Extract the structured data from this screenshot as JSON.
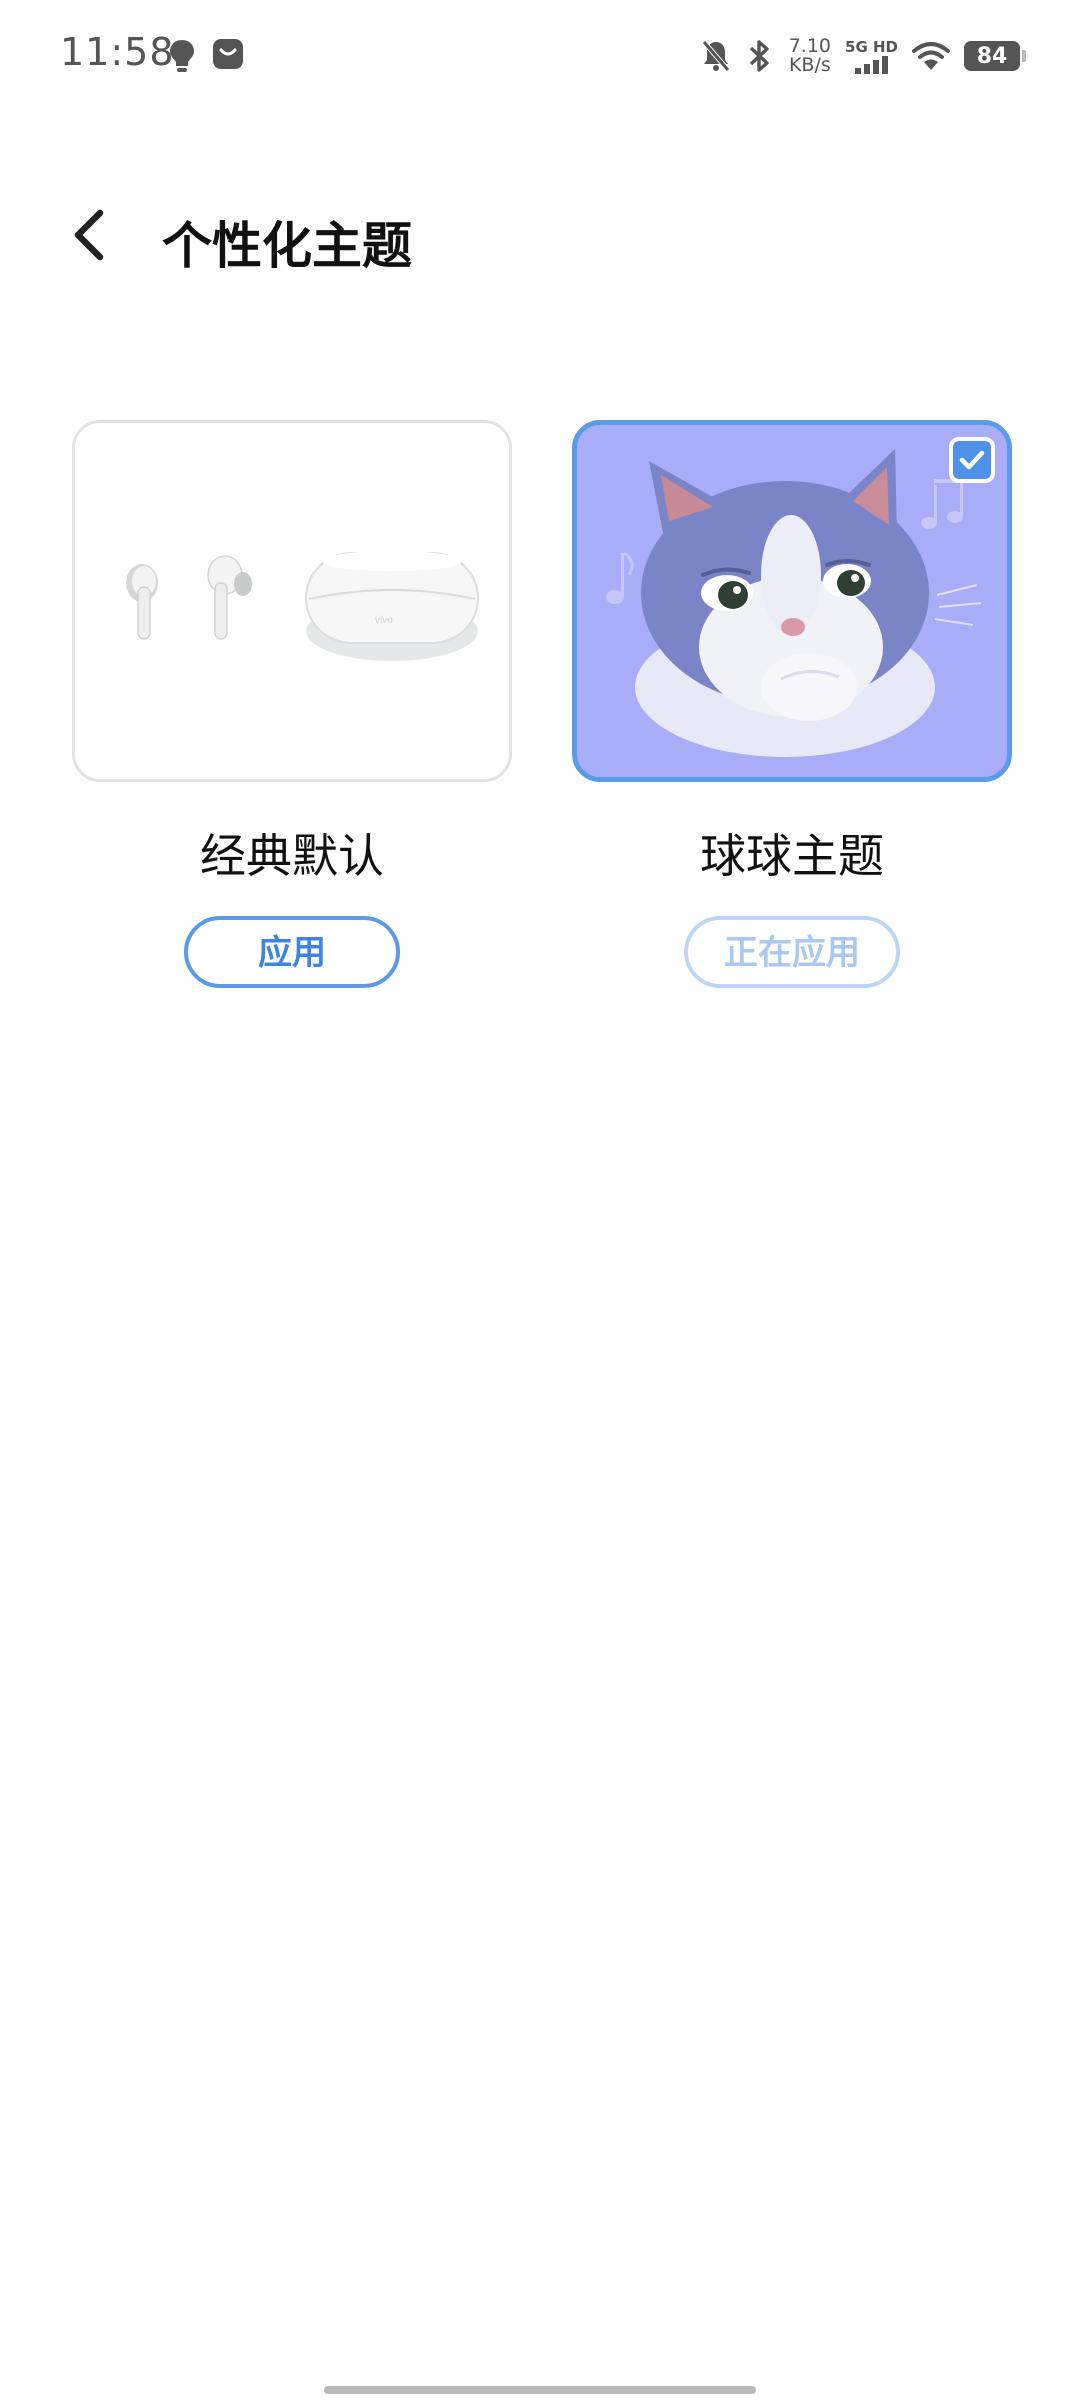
{
  "status_bar": {
    "time": "11:58",
    "net_speed_value": "7.10",
    "net_speed_unit": "KB/s",
    "network_label": "5G HD",
    "battery": "84",
    "icons": [
      "bulb-icon",
      "shop-bag-icon",
      "mute-bell-icon",
      "bluetooth-icon",
      "signal-icon",
      "wifi-icon",
      "battery-icon"
    ]
  },
  "header": {
    "back_icon": "chevron-left-icon",
    "title": "个性化主题"
  },
  "themes": [
    {
      "name": "经典默认",
      "button_label": "应用",
      "selected": false,
      "preview": "earbuds-image"
    },
    {
      "name": "球球主题",
      "button_label": "正在应用",
      "selected": true,
      "preview": "cat-image"
    }
  ],
  "colors": {
    "accent": "#5b9ae8",
    "accent_text": "#3d85e0",
    "disabled_border": "#bcd6f6",
    "disabled_text": "#a9c9f2",
    "selected_bg": "#a9acf6"
  }
}
